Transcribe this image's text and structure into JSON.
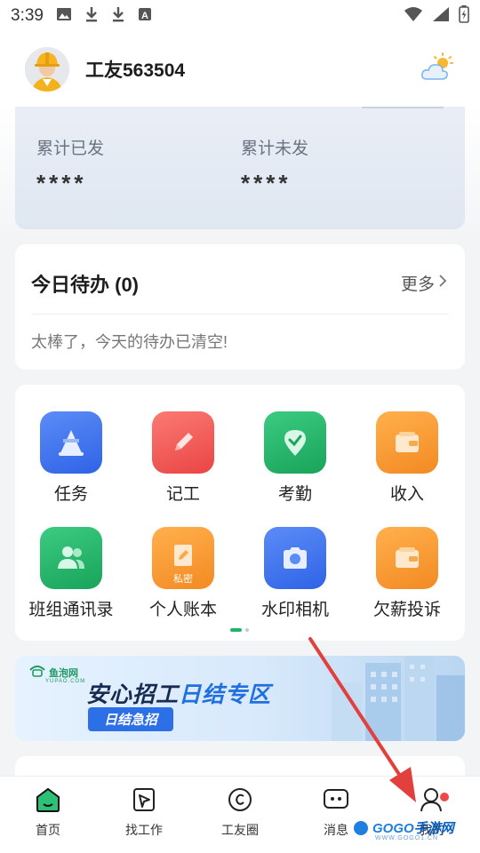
{
  "status_bar": {
    "time": "3:39",
    "icons": [
      "image-icon",
      "download-icon",
      "download-icon",
      "text-a-icon"
    ],
    "right_icons": [
      "wifi-icon",
      "signal-icon",
      "battery-charging-icon"
    ]
  },
  "header": {
    "username": "工友563504",
    "avatar": "worker-avatar",
    "weather_icon": "partly-cloudy-icon"
  },
  "stats": {
    "issued_label": "累计已发",
    "issued_value": "****",
    "unissued_label": "累计未发",
    "unissued_value": "****"
  },
  "todo": {
    "title": "今日待办 (0)",
    "more": "更多",
    "empty_text": "太棒了，今天的待办已清空!"
  },
  "grid": {
    "items": [
      {
        "label": "任务",
        "icon": "cone-icon",
        "color": "#3d6ff0"
      },
      {
        "label": "记工",
        "icon": "pencil-icon",
        "color": "#f05252"
      },
      {
        "label": "考勤",
        "icon": "location-check-icon",
        "color": "#1fae62"
      },
      {
        "label": "收入",
        "icon": "wallet-icon",
        "color": "#f5962f"
      },
      {
        "label": "班组通讯录",
        "icon": "contacts-icon",
        "color": "#1fae62"
      },
      {
        "label": "个人账本",
        "icon": "ledger-icon",
        "color": "#f5962f",
        "tag": "私密"
      },
      {
        "label": "水印相机",
        "icon": "camera-icon",
        "color": "#3d6ff0"
      },
      {
        "label": "欠薪投诉",
        "icon": "wallet-icon",
        "color": "#f5962f"
      }
    ],
    "page_indicator": {
      "current": 1,
      "total": 2
    }
  },
  "banner": {
    "brand": "鱼泡网",
    "brand_sub": "YUPAO.COM",
    "title_black": "安心招工",
    "title_blue": "日结专区",
    "button": "日结急招"
  },
  "tabbar": {
    "tabs": [
      {
        "label": "首页",
        "icon": "home-icon",
        "active": true
      },
      {
        "label": "找工作",
        "icon": "find-job-icon"
      },
      {
        "label": "工友圈",
        "icon": "circle-icon"
      },
      {
        "label": "消息",
        "icon": "message-icon"
      },
      {
        "label": "我的",
        "icon": "profile-icon",
        "badge": true
      }
    ]
  },
  "watermark": {
    "brand": "GOGO",
    "brand_cn": "手游网",
    "url": "WWW.GOGO1.CN"
  },
  "colors": {
    "accent_green": "#1fb36b",
    "annotation_red": "#e2403c"
  }
}
